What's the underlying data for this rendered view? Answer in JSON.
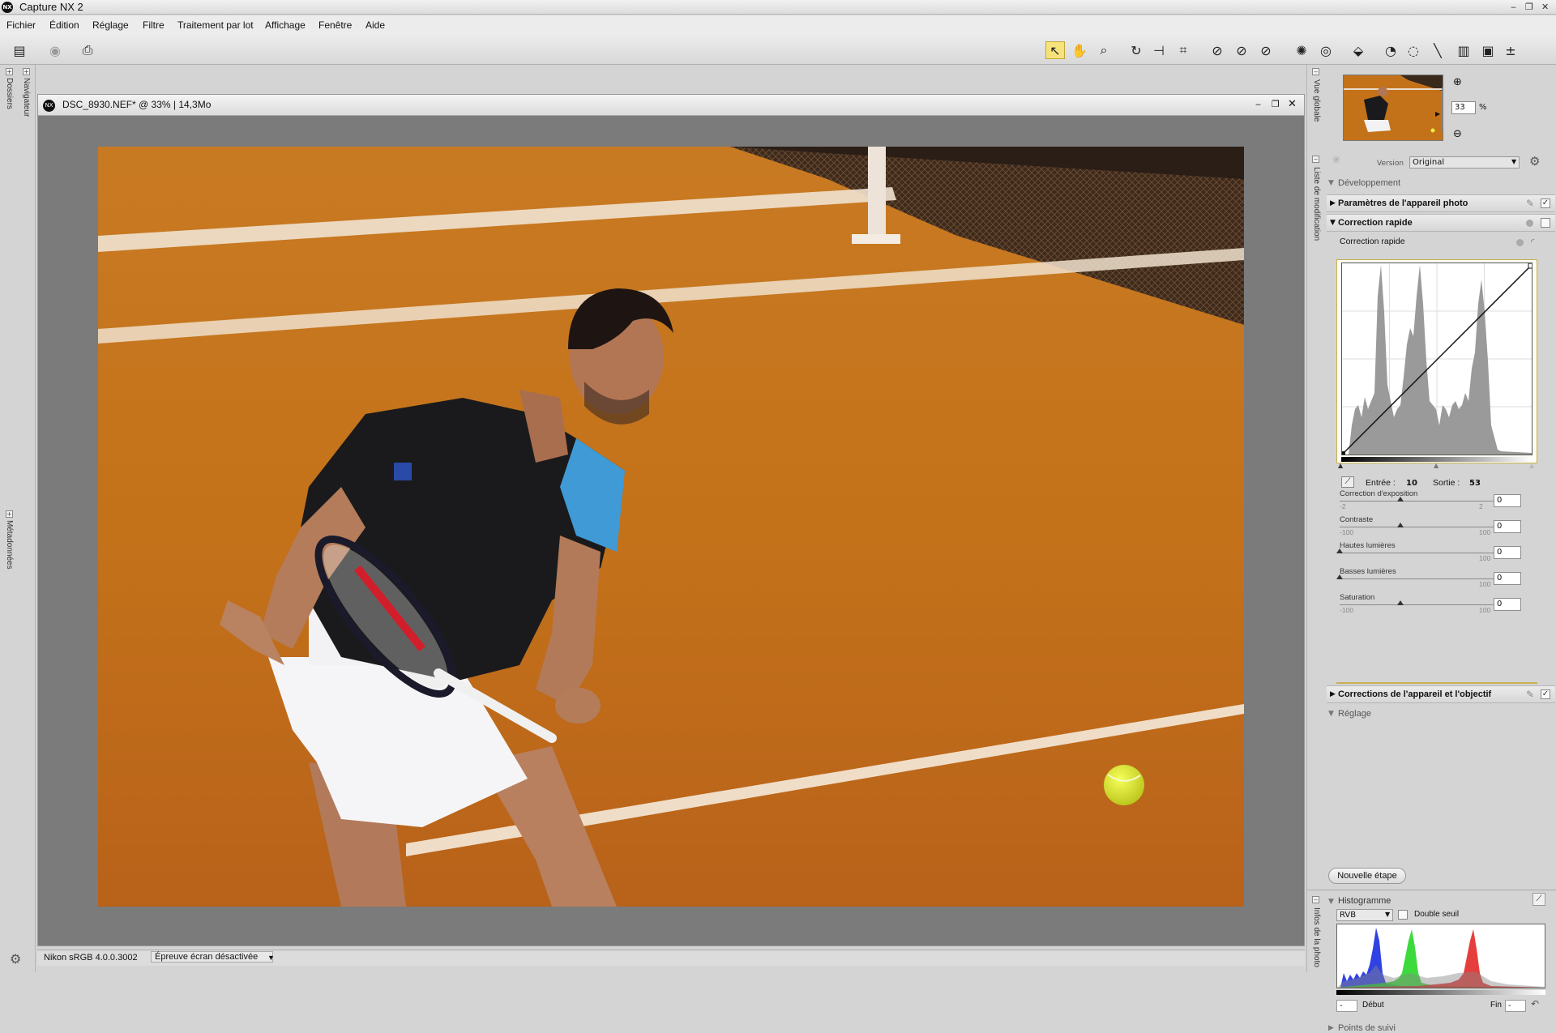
{
  "app": {
    "title": "Capture NX 2",
    "logo": "NX"
  },
  "menu": [
    "Fichier",
    "Édition",
    "Réglage",
    "Filtre",
    "Traitement par lot",
    "Affichage",
    "Fenêtre",
    "Aide"
  ],
  "left_tabs": {
    "dossiers": "Dossiers",
    "navigateur": "Navigateur",
    "metadonnees": "Métadonnées"
  },
  "document": {
    "title": "DSC_8930.NEF* @ 33% | 14,3Mo"
  },
  "overview": {
    "tab": "Vue globale",
    "zoom": "33",
    "zoom_unit": "%"
  },
  "edit_list": {
    "tab": "Liste de modification",
    "version_label": "Version",
    "version_value": "Original",
    "development_label": "Développement",
    "camera_settings": "Paramètres de l'appareil photo",
    "quick_fix": "Correction rapide",
    "quick_fix_sub": "Correction rapide",
    "input_label": "Entrée :",
    "input_value": "10",
    "output_label": "Sortie :",
    "output_value": "53",
    "sliders": [
      {
        "label": "Correction d'exposition",
        "min": "-2",
        "max": "2",
        "value": "0",
        "position": 0.5
      },
      {
        "label": "Contraste",
        "min": "-100",
        "max": "100",
        "value": "0",
        "position": 0.5
      },
      {
        "label": "Hautes lumières",
        "min": "",
        "max": "100",
        "value": "0",
        "position": 0.0
      },
      {
        "label": "Basses lumières",
        "min": "",
        "max": "100",
        "value": "0",
        "position": 0.0
      },
      {
        "label": "Saturation",
        "min": "-100",
        "max": "100",
        "value": "0",
        "position": 0.5
      }
    ],
    "lens_corrections": "Corrections de l'appareil et l'objectif",
    "adjust_label": "Réglage",
    "new_step_button": "Nouvelle étape"
  },
  "histogram": {
    "tab": "Infos de la photo",
    "title": "Histogramme",
    "channel": "RVB",
    "double_threshold": "Double seuil",
    "start_label": "Début",
    "end_label": "Fin",
    "start_value": "-",
    "end_value": "-"
  },
  "tracking": {
    "label": "Points de suivi"
  },
  "status": {
    "profile": "Nikon sRGB 4.0.0.3002",
    "proof": "Épreuve écran désactivée"
  },
  "colors": {
    "clay": "#c5721a",
    "toolbar_selected": "#f6e27a",
    "histo_red": "#e21b1b",
    "histo_green": "#1bd41b",
    "histo_blue": "#1b2ee0"
  }
}
